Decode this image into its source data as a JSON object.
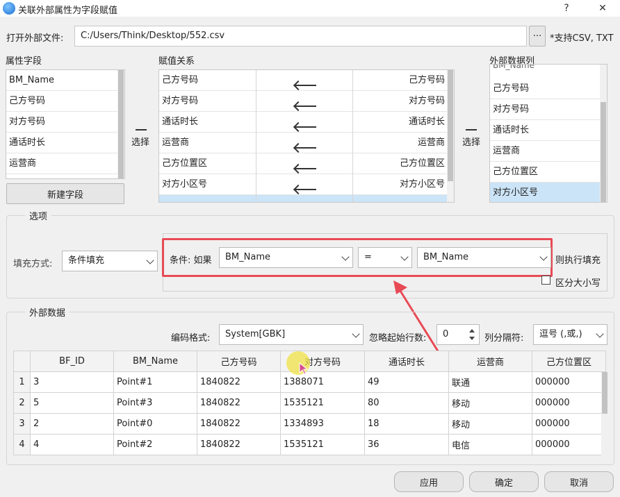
{
  "window": {
    "title": "关联外部属性为字段赋值",
    "help_glyph": "?",
    "close_glyph": "✕"
  },
  "file": {
    "label": "打开外部文件:",
    "path": "C:/Users/Think/Desktop/552.csv",
    "browse_label": "···",
    "support_note": "*支持CSV, TXT"
  },
  "attribute_fields": {
    "header": "属性字段",
    "items": [
      "BM_Name",
      "己方号码",
      "对方号码",
      "通话时长",
      "运营商"
    ],
    "new_field_button": "新建字段",
    "select_label": "选择"
  },
  "assignment": {
    "header": "赋值关系",
    "rows": [
      {
        "left": "己方号码",
        "right": "己方号码"
      },
      {
        "left": "对方号码",
        "right": "对方号码"
      },
      {
        "left": "通话时长",
        "right": "通话时长"
      },
      {
        "left": "运营商",
        "right": "运营商"
      },
      {
        "left": "己方位置区",
        "right": "己方位置区"
      },
      {
        "left": "对方小区号",
        "right": "对方小区号"
      }
    ]
  },
  "external_columns": {
    "header": "外部数据列",
    "partial_item": "BM_Name",
    "items": [
      "己方号码",
      "对方号码",
      "通话时长",
      "运营商",
      "己方位置区",
      "对方小区号"
    ],
    "selected_index": 5,
    "select_label": "选择"
  },
  "options": {
    "group_title": "选项",
    "fill_mode_label": "填充方式:",
    "fill_mode_value": "条件填充",
    "condition_prefix": "条件: 如果",
    "condition_field": "BM_Name",
    "condition_operator": "=",
    "condition_value": "BM_Name",
    "then_label": "则执行填充",
    "case_sensitive_label": "区分大小写",
    "case_sensitive_checked": false
  },
  "external_data": {
    "group_title": "外部数据",
    "encoding_label": "编码格式:",
    "encoding_value": "System[GBK]",
    "skip_rows_label": "忽略起始行数:",
    "skip_rows_value": "0",
    "separator_label": "列分隔符:",
    "separator_value": "逗号 (,或,)",
    "columns": [
      "BF_ID",
      "BM_Name",
      "己方号码",
      "对方号码",
      "通话时长",
      "运营商",
      "己方位置区"
    ],
    "rows": [
      {
        "num": "1",
        "cells": [
          "3",
          "Point#1",
          "1840822",
          "1388071",
          "49",
          "联通",
          "000000"
        ]
      },
      {
        "num": "2",
        "cells": [
          "5",
          "Point#3",
          "1840822",
          "1535121",
          "80",
          "移动",
          "000000"
        ]
      },
      {
        "num": "3",
        "cells": [
          "2",
          "Point#0",
          "1840822",
          "1334893",
          "18",
          "移动",
          "000000"
        ]
      },
      {
        "num": "4",
        "cells": [
          "4",
          "Point#2",
          "1840822",
          "1535121",
          "36",
          "电信",
          "000000"
        ]
      }
    ]
  },
  "footer": {
    "apply": "应用",
    "ok": "确定",
    "cancel": "取消"
  },
  "colors": {
    "highlight_red": "#e84a55",
    "selected_blue": "#cce4f7"
  }
}
